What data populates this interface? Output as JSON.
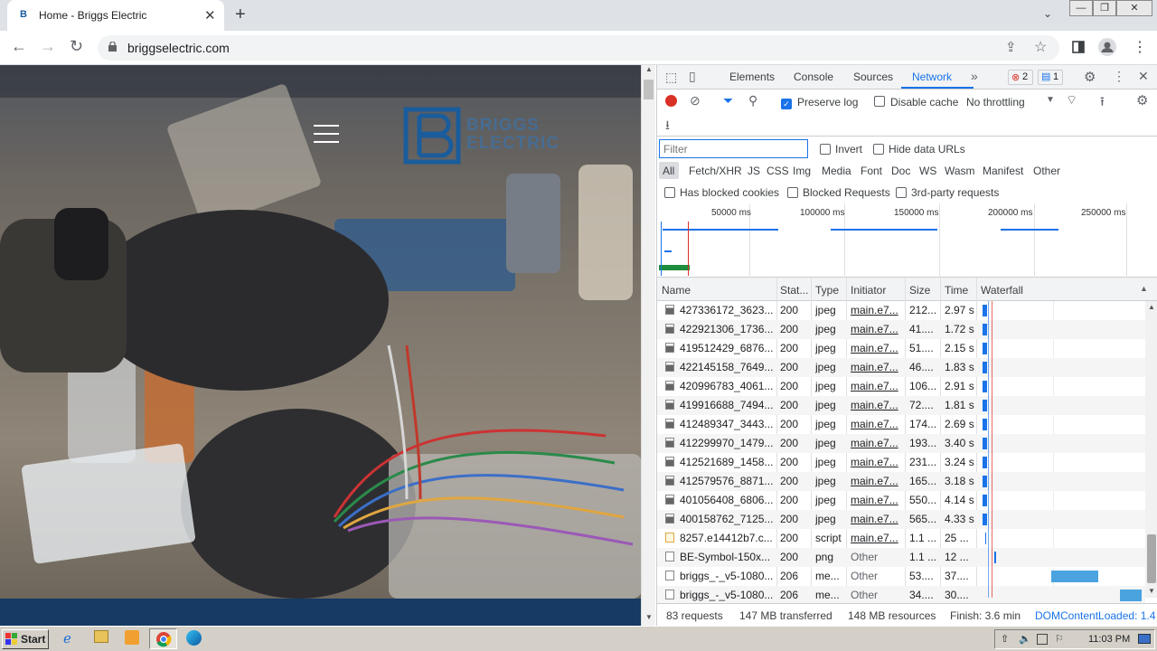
{
  "browser": {
    "tab_title": "Home - Briggs Electric",
    "tab_favicon": "B",
    "url": "briggselectric.com"
  },
  "page": {
    "logo_line1": "BRIGGS",
    "logo_line2": "ELECTRIC"
  },
  "devtools": {
    "tabs": [
      "Elements",
      "Console",
      "Sources",
      "Network"
    ],
    "active_tab": "Network",
    "error_count": "2",
    "message_count": "1",
    "toolbar": {
      "preserve_log": "Preserve log",
      "disable_cache": "Disable cache",
      "throttling": "No throttling"
    },
    "filter_placeholder": "Filter",
    "invert": "Invert",
    "hide_data_urls": "Hide data URLs",
    "type_filters": [
      "All",
      "Fetch/XHR",
      "JS",
      "CSS",
      "Img",
      "Media",
      "Font",
      "Doc",
      "WS",
      "Wasm",
      "Manifest",
      "Other"
    ],
    "has_blocked_cookies": "Has blocked cookies",
    "blocked_requests": "Blocked Requests",
    "third_party": "3rd-party requests",
    "overview_ticks": [
      "50000 ms",
      "100000 ms",
      "150000 ms",
      "200000 ms",
      "250000 ms"
    ],
    "columns": [
      "Name",
      "Stat...",
      "Type",
      "Initiator",
      "Size",
      "Time",
      "Waterfall"
    ],
    "requests": [
      {
        "name": "427336172_3623...",
        "status": "200",
        "type": "jpeg",
        "initiator": "main.e7...",
        "size": "212...",
        "time": "2.97 s"
      },
      {
        "name": "422921306_1736...",
        "status": "200",
        "type": "jpeg",
        "initiator": "main.e7...",
        "size": "41....",
        "time": "1.72 s"
      },
      {
        "name": "419512429_6876...",
        "status": "200",
        "type": "jpeg",
        "initiator": "main.e7...",
        "size": "51....",
        "time": "2.15 s"
      },
      {
        "name": "422145158_7649...",
        "status": "200",
        "type": "jpeg",
        "initiator": "main.e7...",
        "size": "46....",
        "time": "1.83 s"
      },
      {
        "name": "420996783_4061...",
        "status": "200",
        "type": "jpeg",
        "initiator": "main.e7...",
        "size": "106...",
        "time": "2.91 s"
      },
      {
        "name": "419916688_7494...",
        "status": "200",
        "type": "jpeg",
        "initiator": "main.e7...",
        "size": "72....",
        "time": "1.81 s"
      },
      {
        "name": "412489347_3443...",
        "status": "200",
        "type": "jpeg",
        "initiator": "main.e7...",
        "size": "174...",
        "time": "2.69 s"
      },
      {
        "name": "412299970_1479...",
        "status": "200",
        "type": "jpeg",
        "initiator": "main.e7...",
        "size": "193...",
        "time": "3.40 s"
      },
      {
        "name": "412521689_1458...",
        "status": "200",
        "type": "jpeg",
        "initiator": "main.e7...",
        "size": "231...",
        "time": "3.24 s"
      },
      {
        "name": "412579576_8871...",
        "status": "200",
        "type": "jpeg",
        "initiator": "main.e7...",
        "size": "165...",
        "time": "3.18 s"
      },
      {
        "name": "401056408_6806...",
        "status": "200",
        "type": "jpeg",
        "initiator": "main.e7...",
        "size": "550...",
        "time": "4.14 s"
      },
      {
        "name": "400158762_7125...",
        "status": "200",
        "type": "jpeg",
        "initiator": "main.e7...",
        "size": "565...",
        "time": "4.33 s"
      },
      {
        "name": "8257.e14412b7.c...",
        "status": "200",
        "type": "script",
        "initiator": "main.e7...",
        "size": "1.1 ...",
        "time": "25 ..."
      },
      {
        "name": "BE-Symbol-150x...",
        "status": "200",
        "type": "png",
        "initiator": "Other",
        "size": "1.1 ...",
        "time": "12 ..."
      },
      {
        "name": "briggs_-_v5-1080...",
        "status": "206",
        "type": "me...",
        "initiator": "Other",
        "size": "53....",
        "time": "37...."
      },
      {
        "name": "briggs_-_v5-1080...",
        "status": "206",
        "type": "me...",
        "initiator": "Other",
        "size": "34....",
        "time": "30...."
      }
    ],
    "status": {
      "requests": "83 requests",
      "transferred": "147 MB transferred",
      "resources": "148 MB resources",
      "finish": "Finish: 3.6 min",
      "dcl": "DOMContentLoaded: 1.4"
    }
  },
  "taskbar": {
    "start": "Start",
    "time": "11:03 PM"
  },
  "colors": {
    "brand_blue": "#1a5c9c",
    "footer_navy": "#163a63",
    "devtools_accent": "#1a73e8"
  }
}
